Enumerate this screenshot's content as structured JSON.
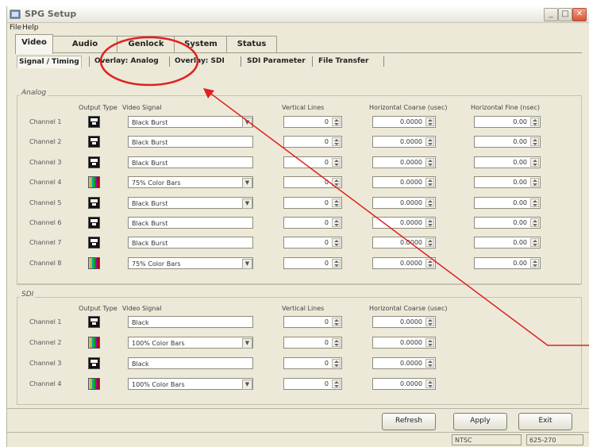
{
  "window": {
    "title": "SPG Setup",
    "controls": [
      "minimize-icon",
      "maximize-icon",
      "close-icon"
    ]
  },
  "menu": {
    "file": "File",
    "help": "Help"
  },
  "main_tabs": [
    {
      "label": "Video",
      "active": true
    },
    {
      "label": "Audio",
      "active": false
    },
    {
      "label": "Genlock",
      "active": false
    },
    {
      "label": "System",
      "active": false
    },
    {
      "label": "Status",
      "active": false
    }
  ],
  "sub_tabs": [
    {
      "label": "Signal / Timing",
      "active": true
    },
    {
      "label": "Overlay: Analog",
      "active": false
    },
    {
      "label": "Overlay: SDI",
      "active": false
    },
    {
      "label": "SDI Parameter",
      "active": false
    },
    {
      "label": "File Transfer",
      "active": false
    }
  ],
  "analog": {
    "group_label": "Analog",
    "headers": {
      "output_type": "Output Type",
      "video_signal": "Video Signal",
      "vertical_lines": "Vertical Lines",
      "h_coarse": "Horizontal Coarse (usec)",
      "h_fine": "Horizontal Fine (nsec)"
    },
    "channels": [
      {
        "label": "Channel 1",
        "icon": "black-burst-icon",
        "signal": "Black Burst",
        "dropdown": true,
        "vertical": "0",
        "coarse": "0.0000",
        "fine": "0.00"
      },
      {
        "label": "Channel 2",
        "icon": "black-burst-icon",
        "signal": "Black Burst",
        "dropdown": false,
        "vertical": "0",
        "coarse": "0.0000",
        "fine": "0.00"
      },
      {
        "label": "Channel 3",
        "icon": "black-burst-icon",
        "signal": "Black Burst",
        "dropdown": false,
        "vertical": "0",
        "coarse": "0.0000",
        "fine": "0.00"
      },
      {
        "label": "Channel 4",
        "icon": "color-bars-icon",
        "signal": "75% Color Bars",
        "dropdown": true,
        "vertical": "0",
        "coarse": "0.0000",
        "fine": "0.00"
      },
      {
        "label": "Channel 5",
        "icon": "black-burst-icon",
        "signal": "Black Burst",
        "dropdown": true,
        "vertical": "0",
        "coarse": "0.0000",
        "fine": "0.00"
      },
      {
        "label": "Channel 6",
        "icon": "black-burst-icon",
        "signal": "Black Burst",
        "dropdown": false,
        "vertical": "0",
        "coarse": "0.0000",
        "fine": "0.00"
      },
      {
        "label": "Channel 7",
        "icon": "black-burst-icon",
        "signal": "Black Burst",
        "dropdown": false,
        "vertical": "0",
        "coarse": "0.0000",
        "fine": "0.00"
      },
      {
        "label": "Channel 8",
        "icon": "color-bars-icon",
        "signal": "75% Color Bars",
        "dropdown": true,
        "vertical": "0",
        "coarse": "0.0000",
        "fine": "0.00"
      }
    ]
  },
  "sdi": {
    "group_label": "SDI",
    "headers": {
      "output_type": "Output Type",
      "video_signal": "Video Signal",
      "vertical_lines": "Vertical Lines",
      "h_coarse": "Horizontal Coarse (usec)"
    },
    "channels": [
      {
        "label": "Channel 1",
        "icon": "black-burst-icon",
        "signal": "Black",
        "dropdown": false,
        "vertical": "0",
        "coarse": "0.0000"
      },
      {
        "label": "Channel 2",
        "icon": "color-bars-icon",
        "signal": "100% Color Bars",
        "dropdown": true,
        "vertical": "0",
        "coarse": "0.0000"
      },
      {
        "label": "Channel 3",
        "icon": "black-burst-icon",
        "signal": "Black",
        "dropdown": false,
        "vertical": "0",
        "coarse": "0.0000"
      },
      {
        "label": "Channel 4",
        "icon": "color-bars-icon",
        "signal": "100% Color Bars",
        "dropdown": true,
        "vertical": "0",
        "coarse": "0.0000"
      }
    ]
  },
  "buttons": {
    "refresh": "Refresh",
    "apply": "Apply",
    "exit": "Exit"
  },
  "status": {
    "standard": "NTSC",
    "format": "625-270"
  },
  "annotation": {
    "color": "#e02020",
    "highlight_target": "Genlock"
  },
  "colors": {
    "window_bg": "#ece9d8",
    "accent_red": "#e02020"
  }
}
